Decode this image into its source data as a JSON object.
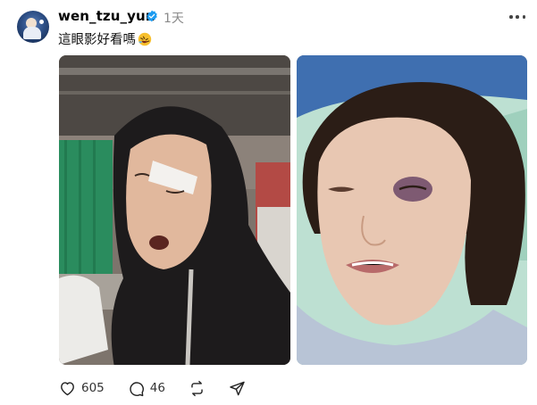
{
  "post": {
    "username": "wen_tzu_yun",
    "time": "1天",
    "caption": "這眼影好看嗎",
    "caption_emoji": "rolling-on-floor-laughing-emoji",
    "photos": [
      {
        "name": "photo-hooded-woman-bandaged-eye"
      },
      {
        "name": "photo-woman-bruised-eye-hospital"
      }
    ]
  },
  "actions": {
    "likes": "605",
    "comments": "46"
  },
  "colors": {
    "verified_badge": "#1d9bf0",
    "text_muted": "#8a8a8a"
  }
}
